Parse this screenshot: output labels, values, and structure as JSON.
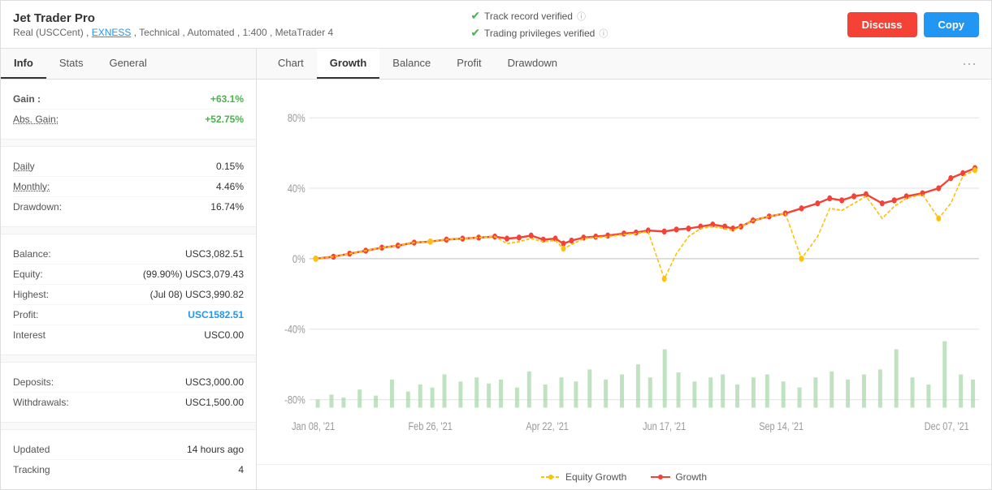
{
  "header": {
    "title": "Jet Trader Pro",
    "subtitle": "Real (USCCent) , EXNESS , Technical , Automated , 1:400 , MetaTrader 4",
    "verified1": "Track record verified",
    "verified2": "Trading privileges verified",
    "discuss_label": "Discuss",
    "copy_label": "Copy"
  },
  "left_tabs": [
    {
      "label": "Info",
      "active": true
    },
    {
      "label": "Stats",
      "active": false
    },
    {
      "label": "General",
      "active": false
    }
  ],
  "stats": {
    "gain_label": "Gain :",
    "gain_value": "+63.1%",
    "abs_gain_label": "Abs. Gain:",
    "abs_gain_value": "+52.75%",
    "daily_label": "Daily",
    "daily_value": "0.15%",
    "monthly_label": "Monthly:",
    "monthly_value": "4.46%",
    "drawdown_label": "Drawdown:",
    "drawdown_value": "16.74%",
    "balance_label": "Balance:",
    "balance_value": "USC3,082.51",
    "equity_label": "Equity:",
    "equity_value": "(99.90%) USC3,079.43",
    "highest_label": "Highest:",
    "highest_value": "(Jul 08) USC3,990.82",
    "profit_label": "Profit:",
    "profit_value": "USC1582.51",
    "interest_label": "Interest",
    "interest_value": "USC0.00",
    "deposits_label": "Deposits:",
    "deposits_value": "USC3,000.00",
    "withdrawals_label": "Withdrawals:",
    "withdrawals_value": "USC1,500.00",
    "updated_label": "Updated",
    "updated_value": "14 hours ago",
    "tracking_label": "Tracking",
    "tracking_value": "4"
  },
  "chart_tabs": [
    {
      "label": "Chart",
      "active": false
    },
    {
      "label": "Growth",
      "active": true
    },
    {
      "label": "Balance",
      "active": false
    },
    {
      "label": "Profit",
      "active": false
    },
    {
      "label": "Drawdown",
      "active": false
    }
  ],
  "chart": {
    "y_labels": [
      "80%",
      "40%",
      "0%",
      "-40%",
      "-80%"
    ],
    "x_labels": [
      "Jan 08, '21",
      "Feb 26, '21",
      "Apr 22, '21",
      "Jun 17, '21",
      "Sep 14, '21",
      "Dec 07, '21"
    ],
    "legend_equity": "Equity Growth",
    "legend_growth": "Growth",
    "equity_color": "#FFC107",
    "growth_color": "#F44336",
    "bar_color": "#A5D6A7"
  },
  "more_icon": "···"
}
